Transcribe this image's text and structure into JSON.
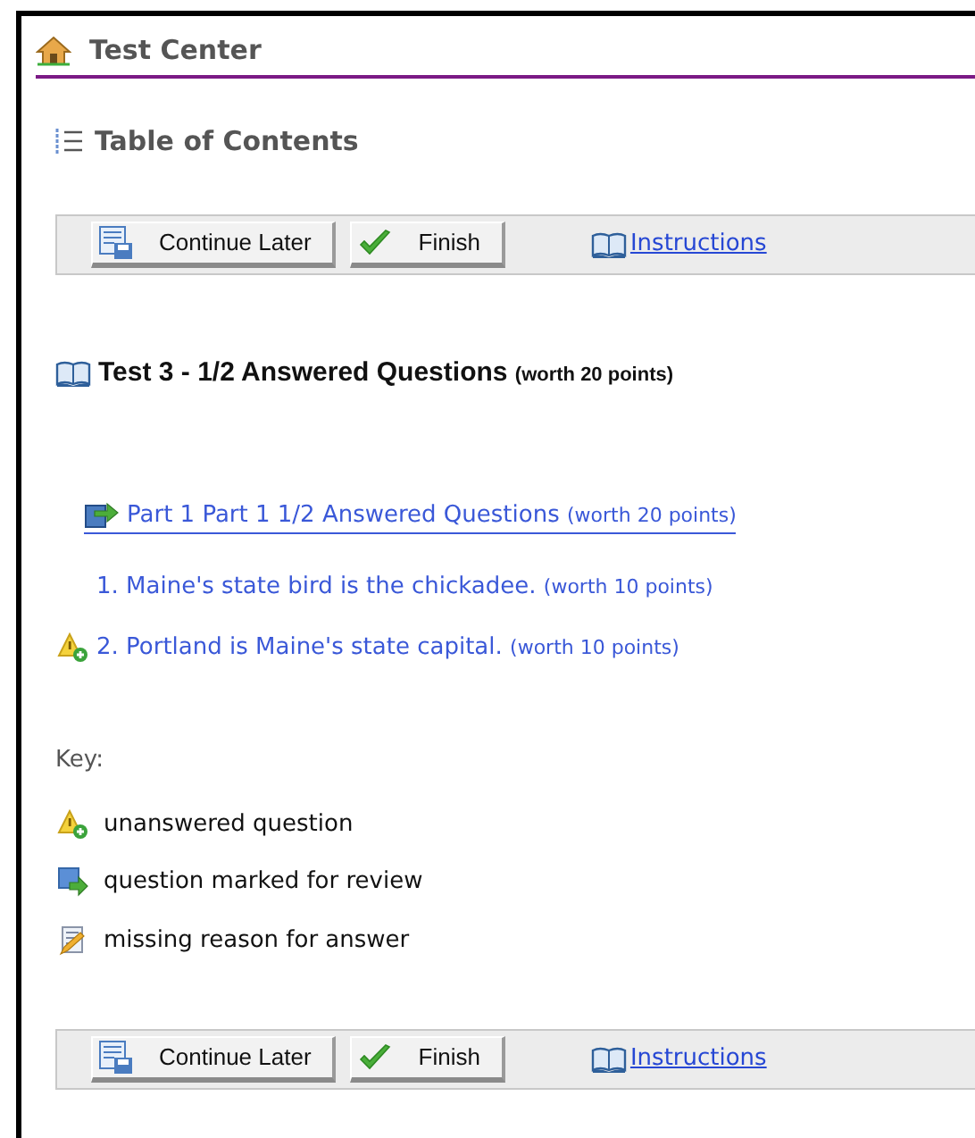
{
  "header": {
    "title": "Test Center"
  },
  "toc_title": "Table of Contents",
  "toolbars": [
    {
      "buttons": [
        {
          "kind": "save",
          "label": "Continue Later"
        },
        {
          "kind": "finish",
          "label": "Finish"
        }
      ],
      "link": "Instructions"
    },
    {
      "buttons": [
        {
          "kind": "save",
          "label": "Continue Later"
        },
        {
          "kind": "finish",
          "label": "Finish"
        }
      ],
      "link": "Instructions"
    }
  ],
  "test": {
    "title": "Test 3 - 1/2 Answered Questions",
    "worth": "(worth 20 points)"
  },
  "part": {
    "title": "Part 1  Part 1  1/2 Answered Questions",
    "worth": "(worth 20 points)",
    "questions": [
      {
        "text": "1. Maine's state bird is the chickadee.",
        "worth": "(worth 10 points)",
        "unanswered": false
      },
      {
        "text": "2. Portland is Maine's state capital.",
        "worth": "(worth 10 points)",
        "unanswered": true
      }
    ]
  },
  "key": {
    "title": "Key:",
    "items": [
      {
        "kind": "unanswered",
        "label": "unanswered question"
      },
      {
        "kind": "review",
        "label": "question marked for review"
      },
      {
        "kind": "reason",
        "label": "missing reason for answer"
      }
    ]
  }
}
